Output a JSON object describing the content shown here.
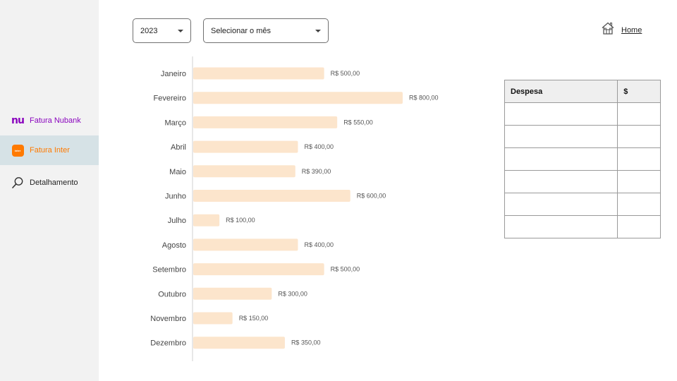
{
  "sidebar": {
    "items": [
      {
        "label": "Fatura Nubank",
        "icon": "nubank-logo-icon",
        "color": "#8a05be",
        "logo_text": "nu"
      },
      {
        "label": "Fatura Inter",
        "icon": "inter-logo-icon",
        "color": "#ff7a00",
        "active": true
      },
      {
        "label": "Detalhamento",
        "icon": "magnifier-icon",
        "color": "#222222"
      }
    ]
  },
  "filters": {
    "year": {
      "value": "2023"
    },
    "month": {
      "placeholder": "Selecionar o mês"
    }
  },
  "header": {
    "home_label": "Home",
    "home_icon": "house-icon"
  },
  "chart_data": {
    "type": "bar",
    "orientation": "horizontal",
    "categories": [
      "Janeiro",
      "Fevereiro",
      "Março",
      "Abril",
      "Maio",
      "Junho",
      "Julho",
      "Agosto",
      "Setembro",
      "Outubro",
      "Novembro",
      "Dezembro"
    ],
    "values": [
      500,
      800,
      550,
      400,
      390,
      600,
      100,
      400,
      500,
      300,
      150,
      350
    ],
    "value_labels": [
      "R$ 500,00",
      "R$ 800,00",
      "R$ 550,00",
      "R$ 400,00",
      "R$ 390,00",
      "R$ 600,00",
      "R$ 100,00",
      "R$ 400,00",
      "R$ 500,00",
      "R$ 300,00",
      "R$ 150,00",
      "R$ 350,00"
    ],
    "bar_color": "#fce5cc",
    "grid": false
  },
  "table": {
    "columns": [
      "Despesa",
      "$"
    ],
    "rows": [
      [
        "",
        ""
      ],
      [
        "",
        ""
      ],
      [
        "",
        ""
      ],
      [
        "",
        ""
      ],
      [
        "",
        ""
      ],
      [
        "",
        ""
      ]
    ]
  }
}
